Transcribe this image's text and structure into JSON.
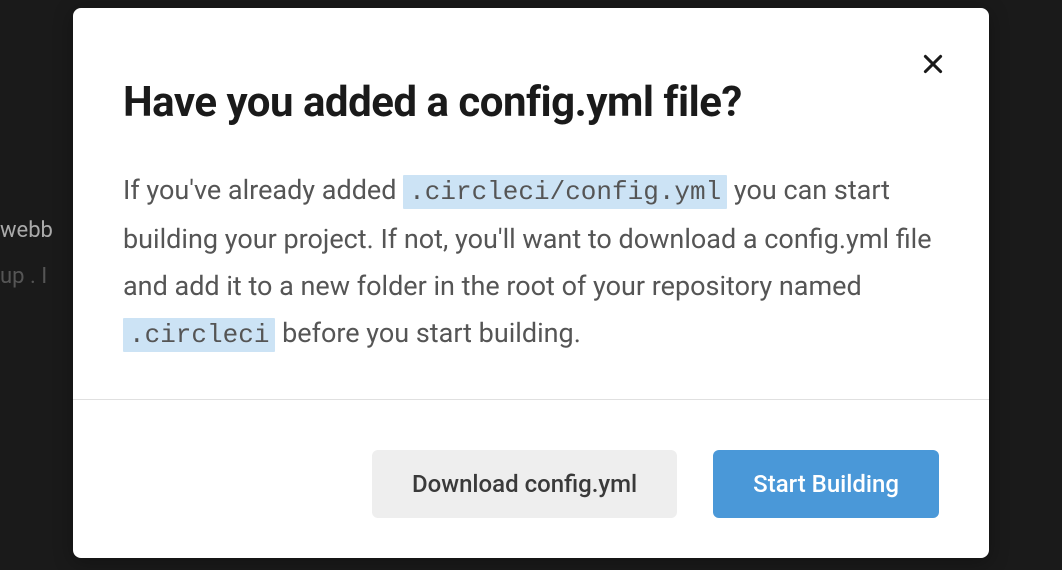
{
  "background": {
    "text1": "webb",
    "text2": "up . I"
  },
  "modal": {
    "title": "Have you added a config.yml file?",
    "description": {
      "part1": "If you've already added ",
      "code1": ".circleci/config.yml",
      "part2": " you can start building your project. If not, you'll want to download a config.yml file and add it to a new folder in the root of your repository named ",
      "code2": ".circleci",
      "part3": " before you start building."
    },
    "buttons": {
      "download": "Download config.yml",
      "start": "Start Building"
    }
  }
}
